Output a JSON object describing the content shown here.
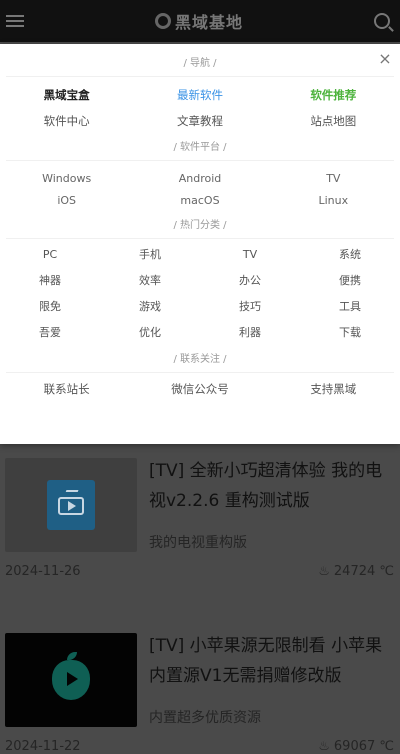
{
  "header": {
    "logo_text": "黑域基地"
  },
  "menu": {
    "nav_title": "/ 导航 /",
    "nav_items": [
      "黑域宝盒",
      "最新软件",
      "软件推荐",
      "软件中心",
      "文章教程",
      "站点地图"
    ],
    "platform_title": "/ 软件平台 /",
    "platform_items": [
      "Windows",
      "Android",
      "TV",
      "iOS",
      "macOS",
      "Linux"
    ],
    "hot_title": "/ 热门分类 /",
    "hot_items": [
      "PC",
      "手机",
      "TV",
      "系统",
      "神器",
      "效率",
      "办公",
      "便携",
      "限免",
      "游戏",
      "技巧",
      "工具",
      "吾爱",
      "优化",
      "利器",
      "下载"
    ],
    "contact_title": "/ 联系关注 /",
    "contact_items": [
      "联系站长",
      "微信公众号",
      "支持黑域"
    ],
    "close": "×"
  },
  "articles": [
    {
      "title": "[TV] 全新小巧超清体验 我的电视v2.2.6 重构测试版",
      "desc": "我的电视重构版",
      "date": "2024-11-26",
      "views": "24724 ℃"
    },
    {
      "title": "[TV] 小苹果源无限制看 小苹果内置源V1无需捐赠修改版",
      "desc": "内置超多优质资源",
      "date": "2024-11-22",
      "views": "69067 ℃"
    }
  ],
  "colors": {
    "accent_blue": "#3a93e6",
    "accent_green": "#4db33d"
  }
}
